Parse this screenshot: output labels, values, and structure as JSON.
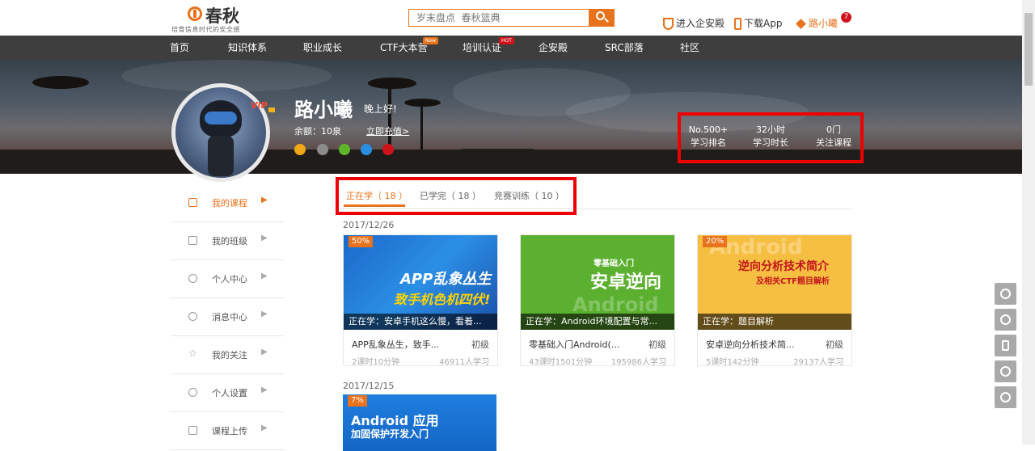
{
  "header": {
    "logo_name": "春秋",
    "logo_slogan": "培育信息时代的安全感",
    "search_placeholder": "岁末盘点  春秋篮典",
    "enterprise_link": "进入企安殿",
    "app_link": "下载App",
    "user_link": "路小曦",
    "notification_count": "7"
  },
  "nav": {
    "items": [
      {
        "label": "首页"
      },
      {
        "label": "知识体系"
      },
      {
        "label": "职业成长"
      },
      {
        "label": "CTF大本营",
        "tag": "New"
      },
      {
        "label": "培训认证",
        "tag": "HOT"
      },
      {
        "label": "企安殿"
      },
      {
        "label": "SRC部落"
      },
      {
        "label": "社区"
      }
    ]
  },
  "profile": {
    "vip_label": "VIP",
    "name": "路小曦",
    "greeting": "晚上好!",
    "balance": "余额：10泉",
    "recharge": "立即充值>",
    "stats": [
      {
        "value": "No.500+",
        "label": "学习排名"
      },
      {
        "value": "32小时",
        "label": "学习时长"
      },
      {
        "value": "0门",
        "label": "关注课程"
      }
    ]
  },
  "sidebar": {
    "items": [
      {
        "label": "我的课程"
      },
      {
        "label": "我的班级"
      },
      {
        "label": "个人中心"
      },
      {
        "label": "消息中心"
      },
      {
        "label": "我的关注"
      },
      {
        "label": "个人设置"
      },
      {
        "label": "课程上传"
      }
    ]
  },
  "tabs": [
    {
      "label": "正在学（ 18 ）"
    },
    {
      "label": "已学完（ 18 ）"
    },
    {
      "label": "竞赛训练（ 10 ）"
    }
  ],
  "groups": [
    {
      "date": "2017/12/26",
      "cards": [
        {
          "progress": "50%",
          "status": "正在学：安卓手机这么慢，看着...",
          "thumb_line1": "APP乱象丛生",
          "thumb_line2": "致手机色机四伏!",
          "title": "APP乱象丛生，致手...",
          "level": "初级",
          "meta": "2课时10分钟",
          "learners": "46911人学习"
        },
        {
          "progress": "",
          "status": "正在学：Android环境配置与常...",
          "thumb_line1": "零基础入门",
          "thumb_line2": "安卓逆向",
          "thumb_line3": "Android",
          "title": "零基础入门Android(...",
          "level": "初级",
          "meta": "43课时1501分钟",
          "learners": "195986人学习"
        },
        {
          "progress": "20%",
          "status": "正在学：题目解析",
          "thumb_line1": "逆向分析技术简介",
          "thumb_line2": "及相关CTF题目解析",
          "thumb_line3": "Android",
          "title": "安卓逆向分析技术简...",
          "level": "初级",
          "meta": "5课时142分钟",
          "learners": "29137人学习"
        }
      ]
    },
    {
      "date": "2017/12/15",
      "cards": [
        {
          "progress": "7%",
          "thumb_line1": "Android 应用",
          "thumb_line2": "加固保护开发入门"
        }
      ]
    }
  ],
  "colors": {
    "accent": "#e8731c",
    "nav_bg": "#3e3e3e",
    "highlight_box": "#ee0000"
  }
}
